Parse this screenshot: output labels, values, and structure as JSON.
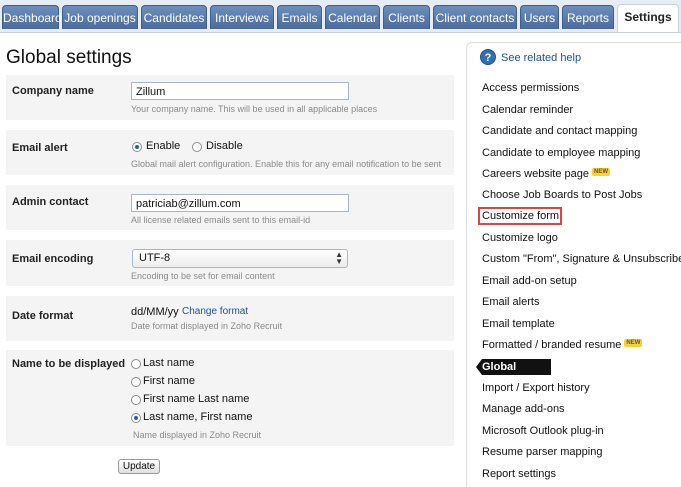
{
  "nav": {
    "tabs": [
      {
        "label": "Dashboard"
      },
      {
        "label": "Job openings"
      },
      {
        "label": "Candidates"
      },
      {
        "label": "Interviews"
      },
      {
        "label": "Emails"
      },
      {
        "label": "Calendar"
      },
      {
        "label": "Clients"
      },
      {
        "label": "Client contacts"
      },
      {
        "label": "Users"
      },
      {
        "label": "Reports"
      },
      {
        "label": "Settings",
        "active": true
      }
    ]
  },
  "main": {
    "title": "Global settings",
    "company": {
      "label": "Company name",
      "value": "Zillum",
      "helper": "Your company name. This will be used in all applicable places"
    },
    "email_alert": {
      "label": "Email alert",
      "enable": "Enable",
      "disable": "Disable",
      "selected": "Enable",
      "helper": "Global mail alert configuration. Enable this for any email notification to be sent"
    },
    "admin": {
      "label": "Admin contact",
      "value": "patriciab@zillum.com",
      "helper": "All license related emails sent to this email-id"
    },
    "encoding": {
      "label": "Email encoding",
      "value": "UTF-8",
      "helper": "Encoding to be set for email content"
    },
    "date_format": {
      "label": "Date format",
      "value": "dd/MM/yy",
      "change_link": "Change format",
      "helper": "Date format displayed in Zoho Recruit"
    },
    "name_display": {
      "label": "Name to be displayed",
      "options": [
        "Last name",
        "First name",
        "First name Last name",
        "Last name, First name"
      ],
      "selected": "Last name, First name",
      "helper": "Name displayed in Zoho Recruit"
    },
    "update_label": "Update"
  },
  "sidebar": {
    "help_icon_glyph": "?",
    "help_label": "See related help",
    "items": [
      {
        "label": "Access permissions"
      },
      {
        "label": "Calendar reminder"
      },
      {
        "label": "Candidate and contact mapping"
      },
      {
        "label": "Candidate to employee mapping"
      },
      {
        "label": "Careers website page",
        "badge": "NEW"
      },
      {
        "label": "Choose Job Boards to Post Jobs"
      },
      {
        "label": "Customize form",
        "highlighted": true
      },
      {
        "label": "Customize logo"
      },
      {
        "label": "Custom \"From\", Signature & Unsubscribe"
      },
      {
        "label": "Email add-on setup"
      },
      {
        "label": "Email alerts"
      },
      {
        "label": "Email template"
      },
      {
        "label": "Formatted / branded resume",
        "badge": "NEW"
      },
      {
        "label": "Global settings",
        "active": true
      },
      {
        "label": "Import / Export history"
      },
      {
        "label": "Manage add-ons"
      },
      {
        "label": "Microsoft Outlook plug-in"
      },
      {
        "label": "Resume parser mapping"
      },
      {
        "label": "Report settings"
      }
    ]
  },
  "colors": {
    "tab": "#4a6b9c",
    "accent": "#1f4e99",
    "highlight": "#e2443a",
    "row_bg": "#f4f4f4"
  }
}
